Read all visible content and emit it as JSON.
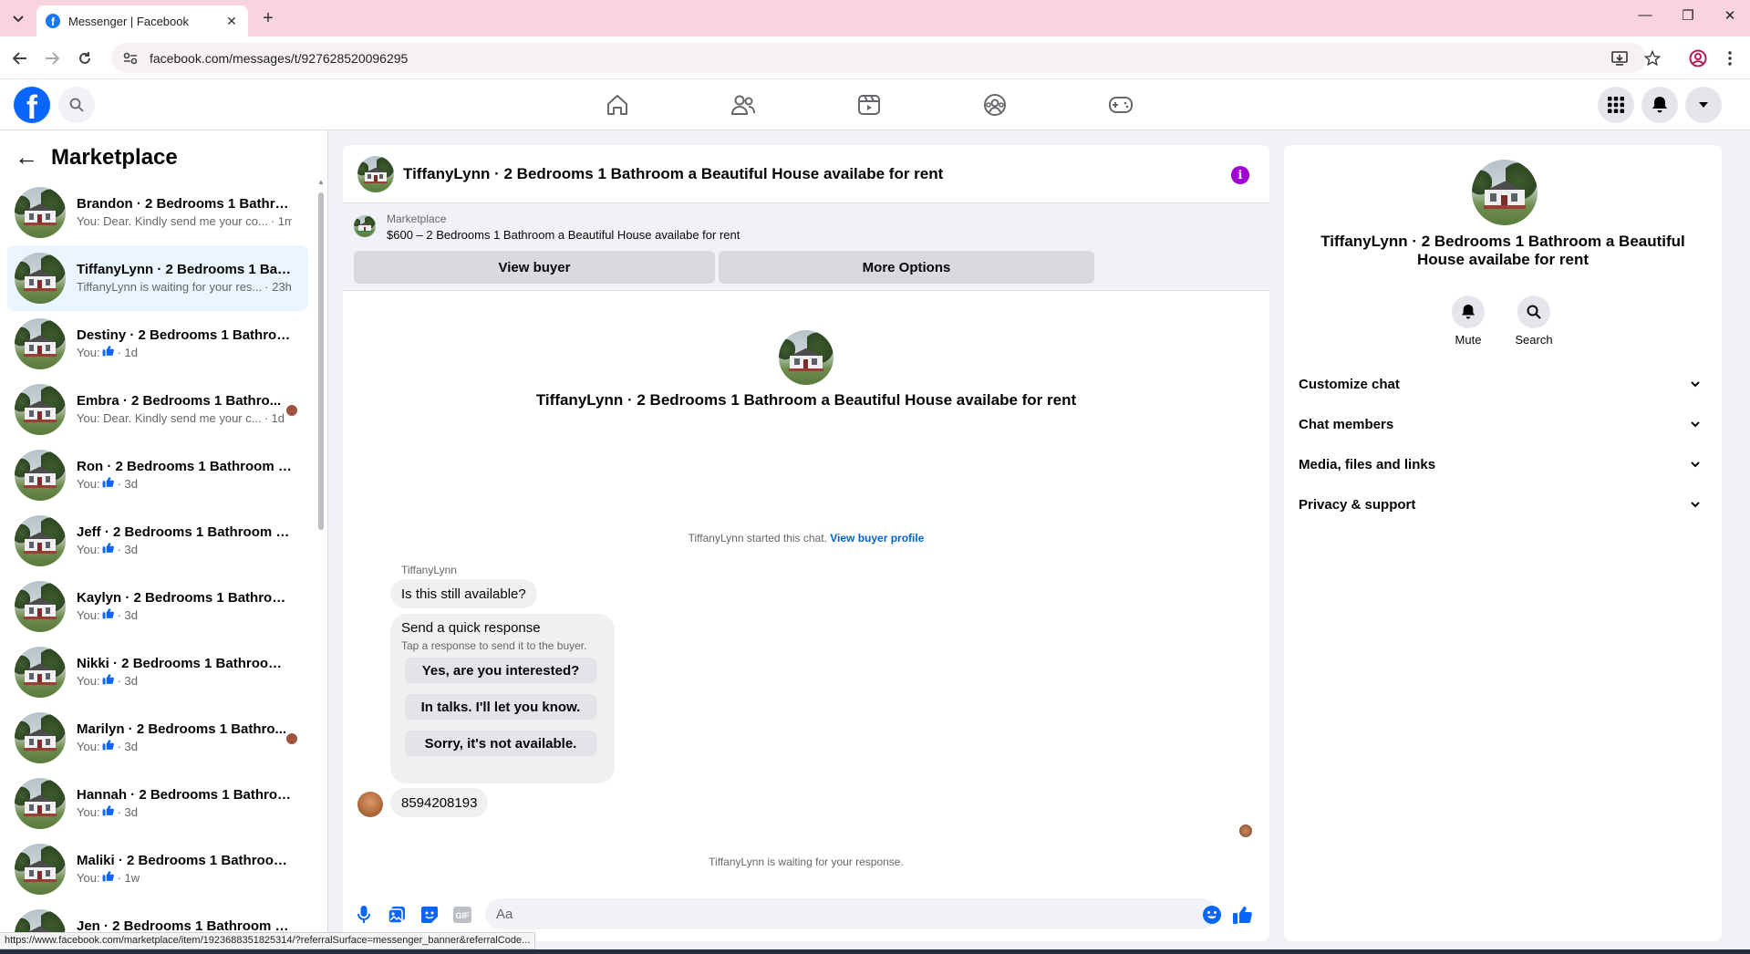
{
  "browser": {
    "tab_title": "Messenger | Facebook",
    "url": "facebook.com/messages/t/927628520096295",
    "status_url": "https://www.facebook.com/marketplace/item/1923688351825314/?referralSurface=messenger_banner&referralCode..."
  },
  "header": {
    "nav": [
      "home-icon",
      "friends-icon",
      "video-icon",
      "groups-icon",
      "gaming-icon"
    ]
  },
  "sidebar": {
    "title": "Marketplace",
    "conversations": [
      {
        "name": "Brandon · 2 Bedrooms 1 Bathroo...",
        "preview": "You: Dear. Kindly send me your co...",
        "time": "· 1m",
        "like": false,
        "unread_avatar": false,
        "active": false
      },
      {
        "name": "TiffanyLynn · 2 Bedrooms 1 Bath...",
        "preview": "TiffanyLynn is waiting for your res...",
        "time": "· 23h",
        "like": false,
        "unread_avatar": false,
        "active": true
      },
      {
        "name": "Destiny · 2 Bedrooms 1 Bathroo...",
        "preview": "You:",
        "time": "· 1d",
        "like": true,
        "unread_avatar": false,
        "active": false
      },
      {
        "name": "Embra · 2 Bedrooms 1 Bathro...",
        "preview": "You: Dear. Kindly send me your c...",
        "time": "· 1d",
        "like": false,
        "unread_avatar": true,
        "active": false
      },
      {
        "name": "Ron · 2 Bedrooms 1 Bathroom a ...",
        "preview": "You:",
        "time": "· 3d",
        "like": true,
        "unread_avatar": false,
        "active": false
      },
      {
        "name": "Jeff · 2 Bedrooms 1 Bathroom a ...",
        "preview": "You:",
        "time": "· 3d",
        "like": true,
        "unread_avatar": false,
        "active": false
      },
      {
        "name": "Kaylyn · 2 Bedrooms 1 Bathroom...",
        "preview": "You:",
        "time": "· 3d",
        "like": true,
        "unread_avatar": false,
        "active": false
      },
      {
        "name": "Nikki · 2 Bedrooms 1 Bathroom ...",
        "preview": "You:",
        "time": "· 3d",
        "like": true,
        "unread_avatar": false,
        "active": false
      },
      {
        "name": "Marilyn · 2 Bedrooms 1 Bathro...",
        "preview": "You:",
        "time": "· 3d",
        "like": true,
        "unread_avatar": true,
        "active": false
      },
      {
        "name": "Hannah · 2 Bedrooms 1 Bathroo...",
        "preview": "You:",
        "time": "· 3d",
        "like": true,
        "unread_avatar": false,
        "active": false
      },
      {
        "name": "Maliki · 2 Bedrooms 1 Bathroom...",
        "preview": "You:",
        "time": "· 1w",
        "like": true,
        "unread_avatar": false,
        "active": false
      },
      {
        "name": "Jen · 2 Bedrooms 1 Bathroom a ...",
        "preview": "You:",
        "time": "· 1w",
        "like": true,
        "unread_avatar": false,
        "active": false
      }
    ]
  },
  "chat": {
    "title": "TiffanyLynn · 2 Bedrooms 1 Bathroom a Beautiful House availabe for rent",
    "banner_label": "Marketplace",
    "listing": "$600 – 2 Bedrooms 1 Bathroom a Beautiful House availabe for rent",
    "view_buyer": "View buyer",
    "more_options": "More Options",
    "intro_title": "TiffanyLynn · 2 Bedrooms 1 Bathroom a Beautiful House availabe for rent",
    "started_text": "TiffanyLynn started this chat.",
    "view_buyer_profile": "View buyer profile",
    "sender": "TiffanyLynn",
    "message1": "Is this still available?",
    "quick_title": "Send a quick response",
    "quick_sub": "Tap a response to send it to the buyer.",
    "quick_replies": [
      "Yes, are you interested?",
      "In talks. I'll let you know.",
      "Sorry, it's not available."
    ],
    "message2": "8594208193",
    "waiting": "TiffanyLynn is waiting for your response.",
    "composer_placeholder": "Aa"
  },
  "details": {
    "title": "TiffanyLynn · 2 Bedrooms 1 Bathroom a Beautiful House availabe for rent",
    "mute": "Mute",
    "search": "Search",
    "rows": [
      "Customize chat",
      "Chat members",
      "Media, files and links",
      "Privacy & support"
    ]
  },
  "colors": {
    "brand": "#0866ff",
    "info": "#a200d2",
    "link": "#0064d1",
    "tabbar": "#f9d3de"
  }
}
